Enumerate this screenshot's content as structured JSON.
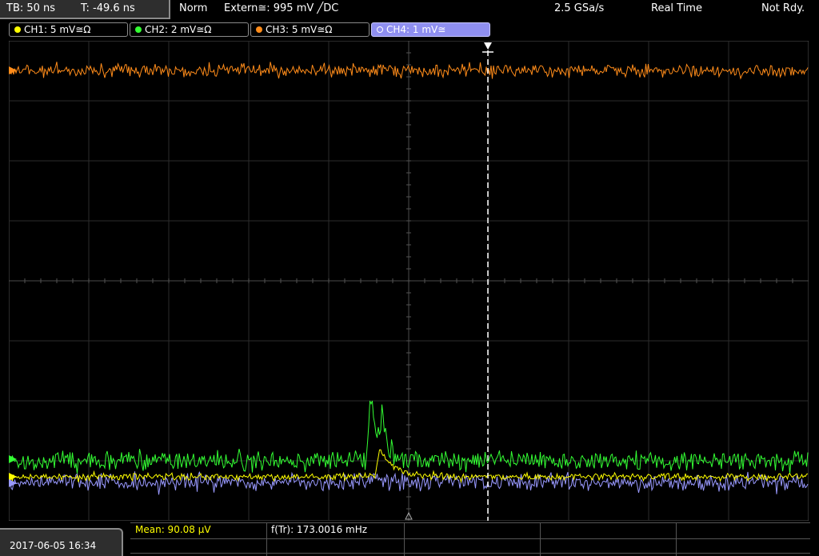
{
  "topbar": {
    "timebase": "TB: 50 ns",
    "trigger_time": "T: -49.6 ns",
    "trigger_mode": "Norm",
    "trigger_source": "Extern≅: 995 mV ╱DC",
    "sample_rate": "2.5 GSa/s",
    "acq_mode": "Real Time",
    "status": "Not Rdy."
  },
  "channels": [
    {
      "id": "ch1",
      "label": "CH1: 5 mV≅Ω",
      "color": "#ffff00",
      "active": false
    },
    {
      "id": "ch2",
      "label": "CH2: 2 mV≅Ω",
      "color": "#33ff33",
      "active": false
    },
    {
      "id": "ch3",
      "label": "CH3: 5 mV≅Ω",
      "color": "#ff8c1a",
      "active": false
    },
    {
      "id": "ch4",
      "label": "CH4: 1 mV≅",
      "color": "#9999ff",
      "active": true
    }
  ],
  "measurements": {
    "mean": "Mean: 90.08 µV",
    "frequency": "f(Tr): 173.0016 mHz"
  },
  "datetime": "2017-06-05 16:34",
  "colors": {
    "ch1": "#ffff00",
    "ch2": "#33ff33",
    "ch3": "#ff8c1a",
    "ch4": "#9999ff",
    "grid": "#333333",
    "cursor": "#ffffff"
  }
}
